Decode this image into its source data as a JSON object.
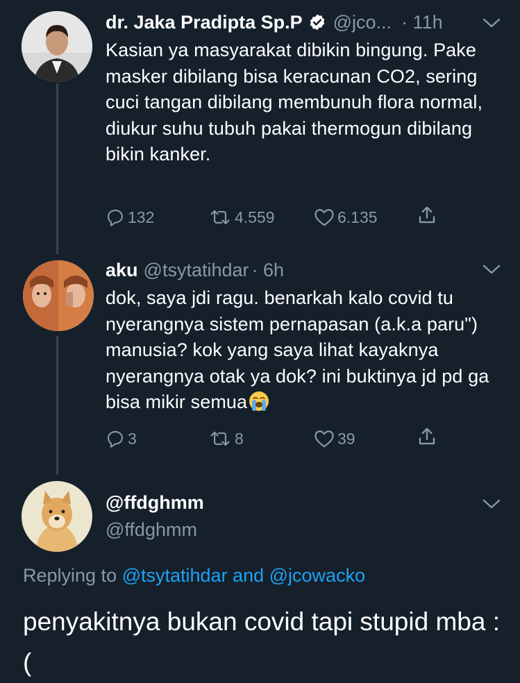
{
  "thread": [
    {
      "display_name": "dr. Jaka Pradipta Sp.P",
      "verified": true,
      "handle": "@jco...",
      "time": "· 11h",
      "text": "Kasian ya masyarakat dibikin bingung. Pake masker dibilang bisa keracunan CO2, sering cuci tangan dibilang membunuh flora normal, diukur suhu tubuh pakai thermogun dibilang bikin kanker.",
      "replies": "132",
      "retweets": "4.559",
      "likes": "6.135"
    },
    {
      "display_name": "aku",
      "handle": "@tsytatihdar",
      "time": "· 6h",
      "text": "dok, saya jdi ragu. benarkah kalo covid tu nyerangnya sistem pernapasan (a.k.a paru\") manusia? kok yang saya lihat kayaknya nyerangnya otak ya dok? ini buktinya jd pd ga bisa mikir semua",
      "emoji": "loudly-crying-face",
      "replies": "3",
      "retweets": "8",
      "likes": "39"
    }
  ],
  "main_tweet": {
    "display_name": "@ffdghmm",
    "handle": "@ffdghmm",
    "replying_prefix": "Replying to ",
    "replying_user1": "@tsytatihdar",
    "replying_and": " and ",
    "replying_user2": "@jcowacko",
    "text": "penyakitnya bukan covid tapi stupid mba :("
  },
  "colors": {
    "background": "#15202b",
    "secondary_text": "#8899a6",
    "accent": "#1da1f2",
    "thread_line": "#38444d"
  },
  "icons": [
    "reply-icon",
    "retweet-icon",
    "like-icon",
    "share-icon",
    "chevron-down-icon",
    "verified-badge-icon"
  ]
}
